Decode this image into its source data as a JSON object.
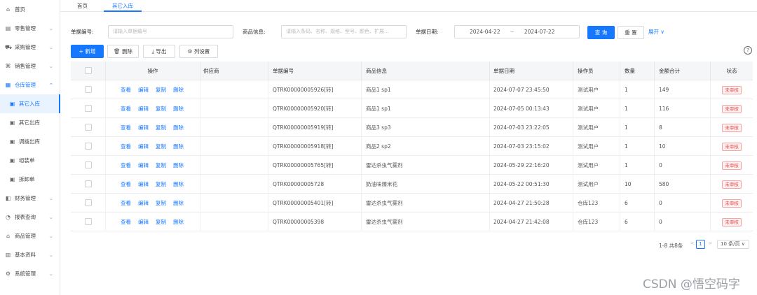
{
  "sidebar": {
    "items": [
      {
        "label": "首页",
        "icon": "home-icon",
        "glyph": "⌂",
        "chev": ""
      },
      {
        "label": "零售管理",
        "icon": "shop-icon",
        "glyph": "▤",
        "chev": "⌄"
      },
      {
        "label": "采购管理",
        "icon": "cart-icon",
        "glyph": "⛟",
        "chev": "⌄"
      },
      {
        "label": "销售管理",
        "icon": "sales-icon",
        "glyph": "⌘",
        "chev": "⌄"
      },
      {
        "label": "仓库管理",
        "icon": "warehouse-icon",
        "glyph": "▦",
        "chev": "⌃"
      },
      {
        "label": "其它入库",
        "icon": "doc-icon",
        "glyph": "▣",
        "chev": ""
      },
      {
        "label": "其它出库",
        "icon": "doc-icon",
        "glyph": "▣",
        "chev": ""
      },
      {
        "label": "调拨出库",
        "icon": "doc-icon",
        "glyph": "▣",
        "chev": ""
      },
      {
        "label": "组装单",
        "icon": "doc-icon",
        "glyph": "▣",
        "chev": ""
      },
      {
        "label": "拆卸单",
        "icon": "doc-icon",
        "glyph": "▣",
        "chev": ""
      },
      {
        "label": "财务管理",
        "icon": "finance-icon",
        "glyph": "◧",
        "chev": "⌄"
      },
      {
        "label": "报表查询",
        "icon": "report-icon",
        "glyph": "◔",
        "chev": "⌄"
      },
      {
        "label": "商品管理",
        "icon": "goods-icon",
        "glyph": "⌂",
        "chev": "⌄"
      },
      {
        "label": "基本资料",
        "icon": "data-icon",
        "glyph": "▥",
        "chev": "⌄"
      },
      {
        "label": "系统管理",
        "icon": "settings-icon",
        "glyph": "⚙",
        "chev": "⌄"
      }
    ]
  },
  "tabs": [
    {
      "label": "首页"
    },
    {
      "label": "其它入库"
    }
  ],
  "search": {
    "bill_no_label": "单据编号:",
    "bill_no_placeholder": "请输入单据编号",
    "goods_label": "商品信息:",
    "goods_placeholder": "请输入条码、名称、规格、型号、颜色、扩展...",
    "date_label": "单据日期:",
    "date_start": "2024-04-22",
    "date_sep": "~",
    "date_end": "2024-07-22",
    "query_label": "查 询",
    "reset_label": "重 置",
    "expand_label": "展开 ∨"
  },
  "toolbar": {
    "add_label": "+ 新增",
    "delete_label": "删除",
    "export_label": "导出",
    "columns_label": "列设置",
    "help_glyph": "?"
  },
  "table": {
    "columns": [
      "操作",
      "供应商",
      "单据编号",
      "商品信息",
      "单据日期",
      "操作员",
      "数量",
      "金额合计",
      "状态"
    ],
    "actions": [
      "查看",
      "编辑",
      "复制",
      "删除"
    ],
    "rows": [
      {
        "supplier": "",
        "bill_no": "QTRK00000005926[转]",
        "goods": "商品1 sp1",
        "date": "2024-07-07 23:45:50",
        "operator": "测试用户",
        "qty": "1",
        "amount": "149",
        "status": "未审核"
      },
      {
        "supplier": "",
        "bill_no": "QTRK00000005920[转]",
        "goods": "商品1 sp1",
        "date": "2024-07-05 00:13:43",
        "operator": "测试用户",
        "qty": "1",
        "amount": "116",
        "status": "未审核"
      },
      {
        "supplier": "",
        "bill_no": "QTRK00000005919[转]",
        "goods": "商品3 sp3",
        "date": "2024-07-03 23:22:05",
        "operator": "测试用户",
        "qty": "1",
        "amount": "8",
        "status": "未审核"
      },
      {
        "supplier": "",
        "bill_no": "QTRK00000005918[转]",
        "goods": "商品2 sp2",
        "date": "2024-07-03 23:15:02",
        "operator": "测试用户",
        "qty": "1",
        "amount": "10",
        "status": "未审核"
      },
      {
        "supplier": "",
        "bill_no": "QTRK00000005765[转]",
        "goods": "雷达杀虫气雾剂",
        "date": "2024-05-29 22:16:20",
        "operator": "测试用户",
        "qty": "1",
        "amount": "0",
        "status": "未审核"
      },
      {
        "supplier": "",
        "bill_no": "QTRK00000005728",
        "goods": "奶油味爆米花",
        "date": "2024-05-22 00:51:30",
        "operator": "测试用户",
        "qty": "10",
        "amount": "580",
        "status": "未审核"
      },
      {
        "supplier": "",
        "bill_no": "QTRK00000005401[转]",
        "goods": "雷达杀虫气雾剂",
        "date": "2024-04-27 21:50:28",
        "operator": "仓库123",
        "qty": "6",
        "amount": "0",
        "status": "未审核"
      },
      {
        "supplier": "",
        "bill_no": "QTRK00000005398",
        "goods": "雷达杀虫气雾剂",
        "date": "2024-04-27 21:42:08",
        "operator": "仓库123",
        "qty": "6",
        "amount": "0",
        "status": "未审核"
      }
    ]
  },
  "pagination": {
    "total_text": "1-8 共8条",
    "prev": "<",
    "current": "1",
    "next": ">",
    "page_size": "10 条/页 ∨"
  },
  "watermark": "CSDN @悟空码字"
}
